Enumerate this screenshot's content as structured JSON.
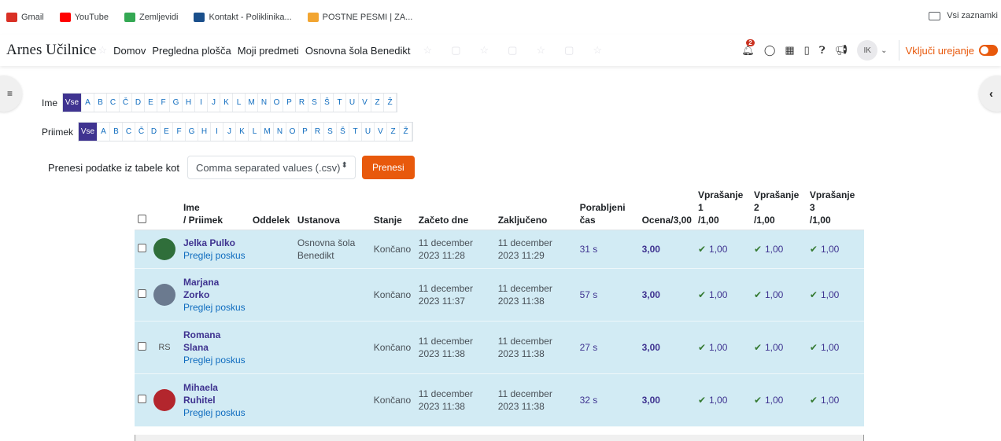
{
  "bookmarks": [
    {
      "label": "Gmail",
      "icon": "gmail-icon",
      "color": "#d93025"
    },
    {
      "label": "YouTube",
      "icon": "youtube-icon",
      "color": "#ff0000"
    },
    {
      "label": "Zemljevidi",
      "icon": "maps-pin-icon",
      "color": "#34a853"
    },
    {
      "label": "Kontakt - Poliklinika...",
      "icon": "clinic-icon",
      "color": "#1a4f8b"
    },
    {
      "label": "POSTNE PESMI | ZA...",
      "icon": "star-logo-icon",
      "color": "#f2a531"
    }
  ],
  "bookmarks_right": "Vsi zaznamki",
  "navbar": {
    "brand": "Arnes Učilnice",
    "links": [
      "Domov",
      "Pregledna plošča",
      "Moji predmeti",
      "Osnovna šola Benedikt"
    ],
    "notification_count": "2",
    "user_initials": "IK",
    "edit_mode_label": "Vključi urejanje"
  },
  "filters": {
    "first_label": "Ime",
    "last_label": "Priimek",
    "all_label": "Vse",
    "letters": [
      "A",
      "B",
      "C",
      "Č",
      "D",
      "E",
      "F",
      "G",
      "H",
      "I",
      "J",
      "K",
      "L",
      "M",
      "N",
      "O",
      "P",
      "R",
      "S",
      "Š",
      "T",
      "U",
      "V",
      "Z",
      "Ž"
    ]
  },
  "download": {
    "label": "Prenesi podatke iz tabele kot",
    "selected_format": "Comma separated values (.csv)",
    "button": "Prenesi"
  },
  "table": {
    "headers": {
      "name_1": "Ime",
      "name_2": "/ Priimek",
      "department": "Oddelek",
      "institution": "Ustanova",
      "state": "Stanje",
      "started": "Začeto dne",
      "completed": "Zaključeno",
      "time_1": "Porabljeni",
      "time_2": "čas",
      "grade": "Ocena/3,00",
      "q1_a": "Vprašanje",
      "q1_b": "1",
      "q1_c": "/1,00",
      "q2_a": "Vprašanje",
      "q2_b": "2",
      "q2_c": "/1,00",
      "q3_a": "Vprašanje",
      "q3_b": "3",
      "q3_c": "/1,00"
    },
    "review_label": "Preglej poskus",
    "rows": [
      {
        "name_lines": [
          "Jelka Pulko"
        ],
        "avatar": "photo",
        "avatar_color": "#2f6e3a",
        "institution_lines": [
          "Osnovna šola",
          "Benedikt"
        ],
        "state": "Končano",
        "started_1": "11 december",
        "started_2": "2023 11:28",
        "completed_1": "11 december",
        "completed_2": "2023 11:29",
        "time": "31 s",
        "grade": "3,00",
        "q": [
          "1,00",
          "1,00",
          "1,00"
        ]
      },
      {
        "name_lines": [
          "Marjana",
          "Zorko"
        ],
        "avatar": "photo",
        "avatar_color": "#6b7a8f",
        "institution_lines": [],
        "state": "Končano",
        "started_1": "11 december",
        "started_2": "2023 11:37",
        "completed_1": "11 december",
        "completed_2": "2023 11:38",
        "time": "57 s",
        "grade": "3,00",
        "q": [
          "1,00",
          "1,00",
          "1,00"
        ]
      },
      {
        "name_lines": [
          "Romana",
          "Slana"
        ],
        "avatar": "RS",
        "avatar_color": "#d2ebf4",
        "institution_lines": [],
        "state": "Končano",
        "started_1": "11 december",
        "started_2": "2023 11:38",
        "completed_1": "11 december",
        "completed_2": "2023 11:38",
        "time": "27 s",
        "grade": "3,00",
        "q": [
          "1,00",
          "1,00",
          "1,00"
        ]
      },
      {
        "name_lines": [
          "Mihaela",
          "Ruhitel"
        ],
        "avatar": "photo",
        "avatar_color": "#b3262d",
        "institution_lines": [],
        "state": "Končano",
        "started_1": "11 december",
        "started_2": "2023 11:38",
        "completed_1": "11 december",
        "completed_2": "2023 11:38",
        "time": "32 s",
        "grade": "3,00",
        "q": [
          "1,00",
          "1,00",
          "1,00"
        ]
      }
    ]
  }
}
